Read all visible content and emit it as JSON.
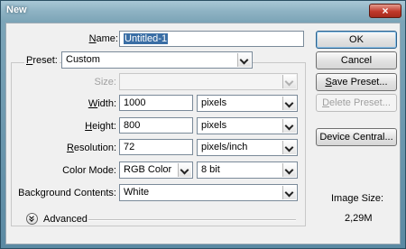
{
  "window": {
    "title": "New",
    "close_glyph": "×"
  },
  "form": {
    "name": {
      "label_prefix": "",
      "label_key": "N",
      "label_rest": "ame:",
      "value": "Untitled-1"
    },
    "preset": {
      "label_key": "P",
      "label_rest": "reset:",
      "value": "Custom"
    },
    "size": {
      "label": "Size:",
      "value": ""
    },
    "width": {
      "label_key": "W",
      "label_rest": "idth:",
      "value": "1000",
      "unit": "pixels"
    },
    "height": {
      "label_key": "H",
      "label_rest": "eight:",
      "value": "800",
      "unit": "pixels"
    },
    "resolution": {
      "label_key": "R",
      "label_rest": "esolution:",
      "value": "72",
      "unit": "pixels/inch"
    },
    "color_mode": {
      "label": "Color Mode:",
      "value": "RGB Color",
      "depth": "8 bit"
    },
    "background": {
      "label": "Background Contents:",
      "value": "White"
    },
    "advanced": {
      "label": "Advanced"
    }
  },
  "buttons": {
    "ok": "OK",
    "cancel": "Cancel",
    "save_preset_key": "S",
    "save_preset_rest": "ave Preset...",
    "delete_preset_key": "D",
    "delete_preset_rest": "elete Preset...",
    "device_central": "Device Central..."
  },
  "image_size": {
    "label": "Image Size:",
    "value": "2,29M"
  },
  "icons": {
    "advanced_toggle": "double-chevron-down-icon",
    "dropdown": "chevron-down-icon"
  }
}
